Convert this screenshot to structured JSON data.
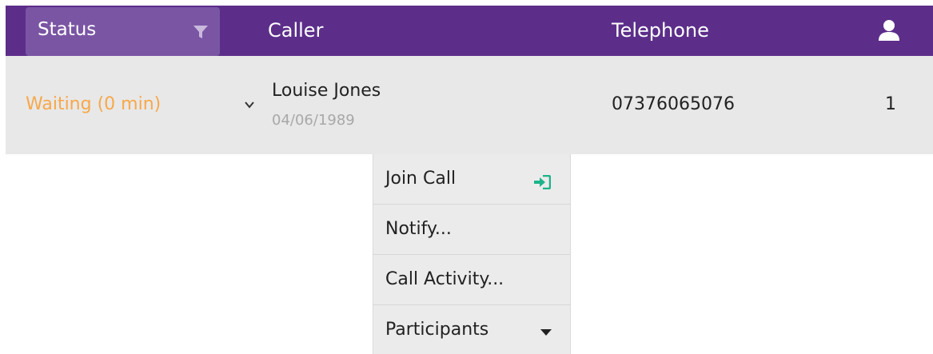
{
  "header": {
    "status_label": "Status",
    "caller_label": "Caller",
    "telephone_label": "Telephone"
  },
  "row": {
    "status": "Waiting (0 min)",
    "caller_name": "Louise Jones",
    "caller_dob": "04/06/1989",
    "telephone": "07376065076",
    "count": "1"
  },
  "menu": {
    "items": [
      {
        "label": "Join Call",
        "icon": "join-call-icon"
      },
      {
        "label": "Notify..."
      },
      {
        "label": "Call Activity..."
      },
      {
        "label": "Participants",
        "icon": "caret-down-icon"
      }
    ]
  },
  "colors": {
    "header_bg": "#5c2e8a",
    "status_filter_bg": "#7a55a4",
    "row_bg": "#e8e8e8",
    "waiting_text": "#f7a84a",
    "join_icon": "#1db38a",
    "dob_text": "#a8a8a8"
  }
}
